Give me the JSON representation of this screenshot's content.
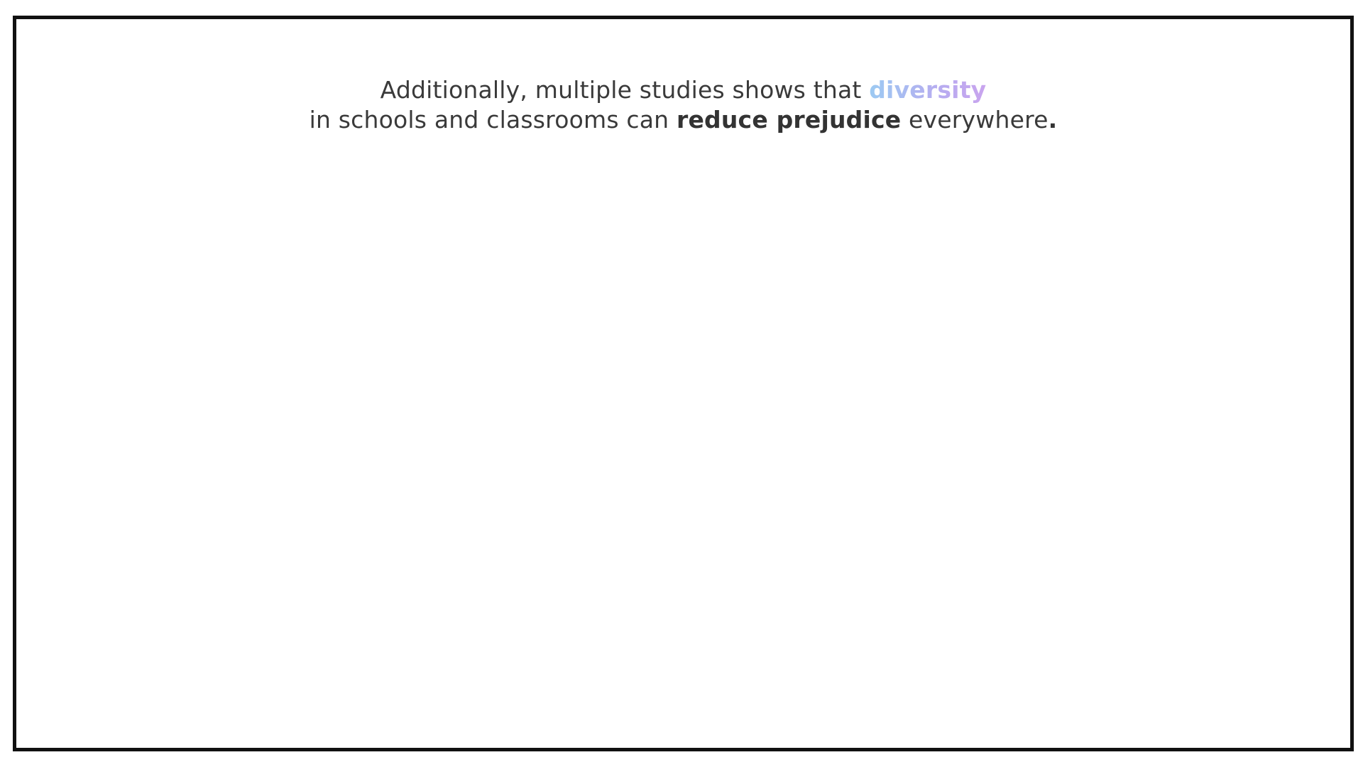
{
  "caption": {
    "line1_prefix": "Additionally, multiple studies shows that ",
    "line1_highlight": "diversity",
    "line2_prefix": "in schools and classrooms can ",
    "line2_bold": "reduce prejudice",
    "line2_suffix": " everywhere",
    "line2_period": "."
  },
  "colors": {
    "frame_border": "#111111",
    "text": "#3a3a3a",
    "gradient_start": "#9ccaf2",
    "gradient_end": "#c9a4ee"
  }
}
